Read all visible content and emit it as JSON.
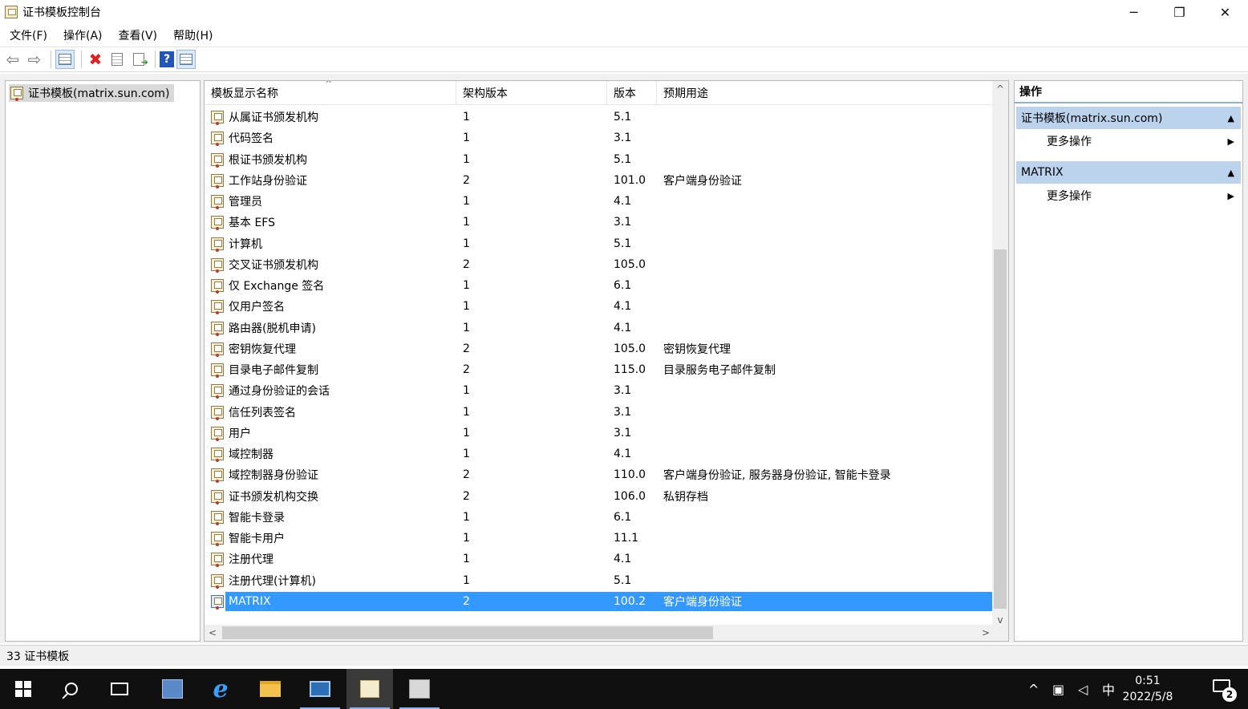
{
  "window": {
    "title": "证书模板控制台",
    "minimize": "─",
    "restore": "❐",
    "close": "✕"
  },
  "menu": [
    "文件(F)",
    "操作(A)",
    "查看(V)",
    "帮助(H)"
  ],
  "toolbar": {
    "back": "⇦",
    "forward": "⇨",
    "delete": "✖",
    "help": "?"
  },
  "tree": {
    "root_label": "证书模板(matrix.sun.com)"
  },
  "list": {
    "columns": [
      "模板显示名称",
      "架构版本",
      "版本",
      "预期用途"
    ],
    "sort_indicator": "^",
    "rows": [
      {
        "name": "从属证书颁发机构",
        "schema": "1",
        "version": "5.1",
        "purpose": ""
      },
      {
        "name": "代码签名",
        "schema": "1",
        "version": "3.1",
        "purpose": ""
      },
      {
        "name": "根证书颁发机构",
        "schema": "1",
        "version": "5.1",
        "purpose": ""
      },
      {
        "name": "工作站身份验证",
        "schema": "2",
        "version": "101.0",
        "purpose": "客户端身份验证"
      },
      {
        "name": "管理员",
        "schema": "1",
        "version": "4.1",
        "purpose": ""
      },
      {
        "name": "基本 EFS",
        "schema": "1",
        "version": "3.1",
        "purpose": ""
      },
      {
        "name": "计算机",
        "schema": "1",
        "version": "5.1",
        "purpose": ""
      },
      {
        "name": "交叉证书颁发机构",
        "schema": "2",
        "version": "105.0",
        "purpose": ""
      },
      {
        "name": "仅 Exchange 签名",
        "schema": "1",
        "version": "6.1",
        "purpose": ""
      },
      {
        "name": "仅用户签名",
        "schema": "1",
        "version": "4.1",
        "purpose": ""
      },
      {
        "name": "路由器(脱机申请)",
        "schema": "1",
        "version": "4.1",
        "purpose": ""
      },
      {
        "name": "密钥恢复代理",
        "schema": "2",
        "version": "105.0",
        "purpose": "密钥恢复代理"
      },
      {
        "name": "目录电子邮件复制",
        "schema": "2",
        "version": "115.0",
        "purpose": "目录服务电子邮件复制"
      },
      {
        "name": "通过身份验证的会话",
        "schema": "1",
        "version": "3.1",
        "purpose": ""
      },
      {
        "name": "信任列表签名",
        "schema": "1",
        "version": "3.1",
        "purpose": ""
      },
      {
        "name": "用户",
        "schema": "1",
        "version": "3.1",
        "purpose": ""
      },
      {
        "name": "域控制器",
        "schema": "1",
        "version": "4.1",
        "purpose": ""
      },
      {
        "name": "域控制器身份验证",
        "schema": "2",
        "version": "110.0",
        "purpose": "客户端身份验证, 服务器身份验证, 智能卡登录"
      },
      {
        "name": "证书颁发机构交换",
        "schema": "2",
        "version": "106.0",
        "purpose": "私钥存档"
      },
      {
        "name": "智能卡登录",
        "schema": "1",
        "version": "6.1",
        "purpose": ""
      },
      {
        "name": "智能卡用户",
        "schema": "1",
        "version": "11.1",
        "purpose": ""
      },
      {
        "name": "注册代理",
        "schema": "1",
        "version": "4.1",
        "purpose": ""
      },
      {
        "name": "注册代理(计算机)",
        "schema": "1",
        "version": "5.1",
        "purpose": ""
      },
      {
        "name": "MATRIX",
        "schema": "2",
        "version": "100.2",
        "purpose": "客户端身份验证",
        "selected": true
      }
    ],
    "scroll_up": "^",
    "scroll_down": "v",
    "scroll_left": "<",
    "scroll_right": ">"
  },
  "actions": {
    "title": "操作",
    "sections": [
      {
        "label": "证书模板(matrix.sun.com)",
        "item": "更多操作"
      },
      {
        "label": "MATRIX",
        "item": "更多操作"
      }
    ],
    "collapse_glyph": "▲",
    "submenu_glyph": "▶"
  },
  "status": {
    "text": "33 证书模板"
  },
  "taskbar": {
    "tray_up": "^",
    "ime": "中",
    "time": "0:51",
    "date": "2022/5/8",
    "notification_count": "2",
    "ie_glyph": "e"
  }
}
